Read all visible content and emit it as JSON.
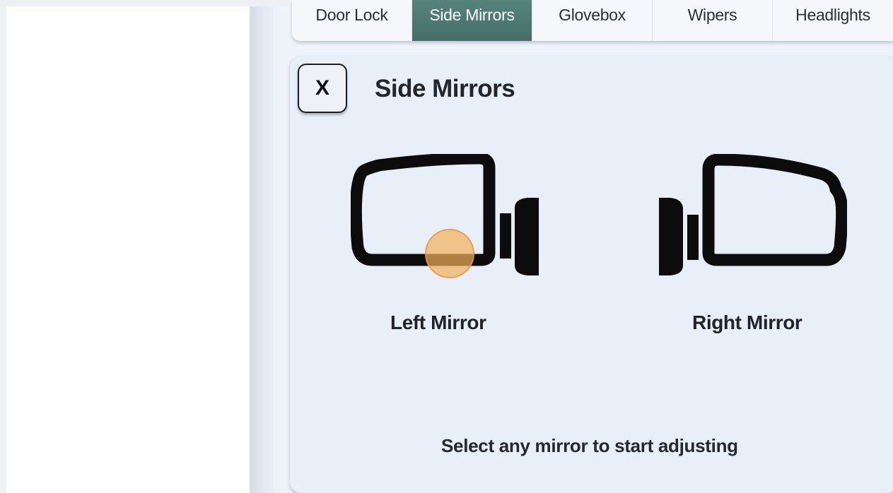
{
  "tabs": [
    {
      "label": "Door Lock",
      "active": false
    },
    {
      "label": "Side Mirrors",
      "active": true
    },
    {
      "label": "Glovebox",
      "active": false
    },
    {
      "label": "Wipers",
      "active": false
    },
    {
      "label": "Headlights",
      "active": false
    }
  ],
  "panel": {
    "close_label": "X",
    "title": "Side Mirrors",
    "left_mirror_label": "Left Mirror",
    "right_mirror_label": "Right Mirror",
    "hint": "Select any mirror to start adjusting"
  },
  "icons": {
    "left_mirror": "left-side-mirror-icon",
    "right_mirror": "right-side-mirror-icon"
  },
  "colors": {
    "active_tab": "#4d7a73",
    "panel_bg": "#e8eff9",
    "cursor": "#f4b25a"
  }
}
